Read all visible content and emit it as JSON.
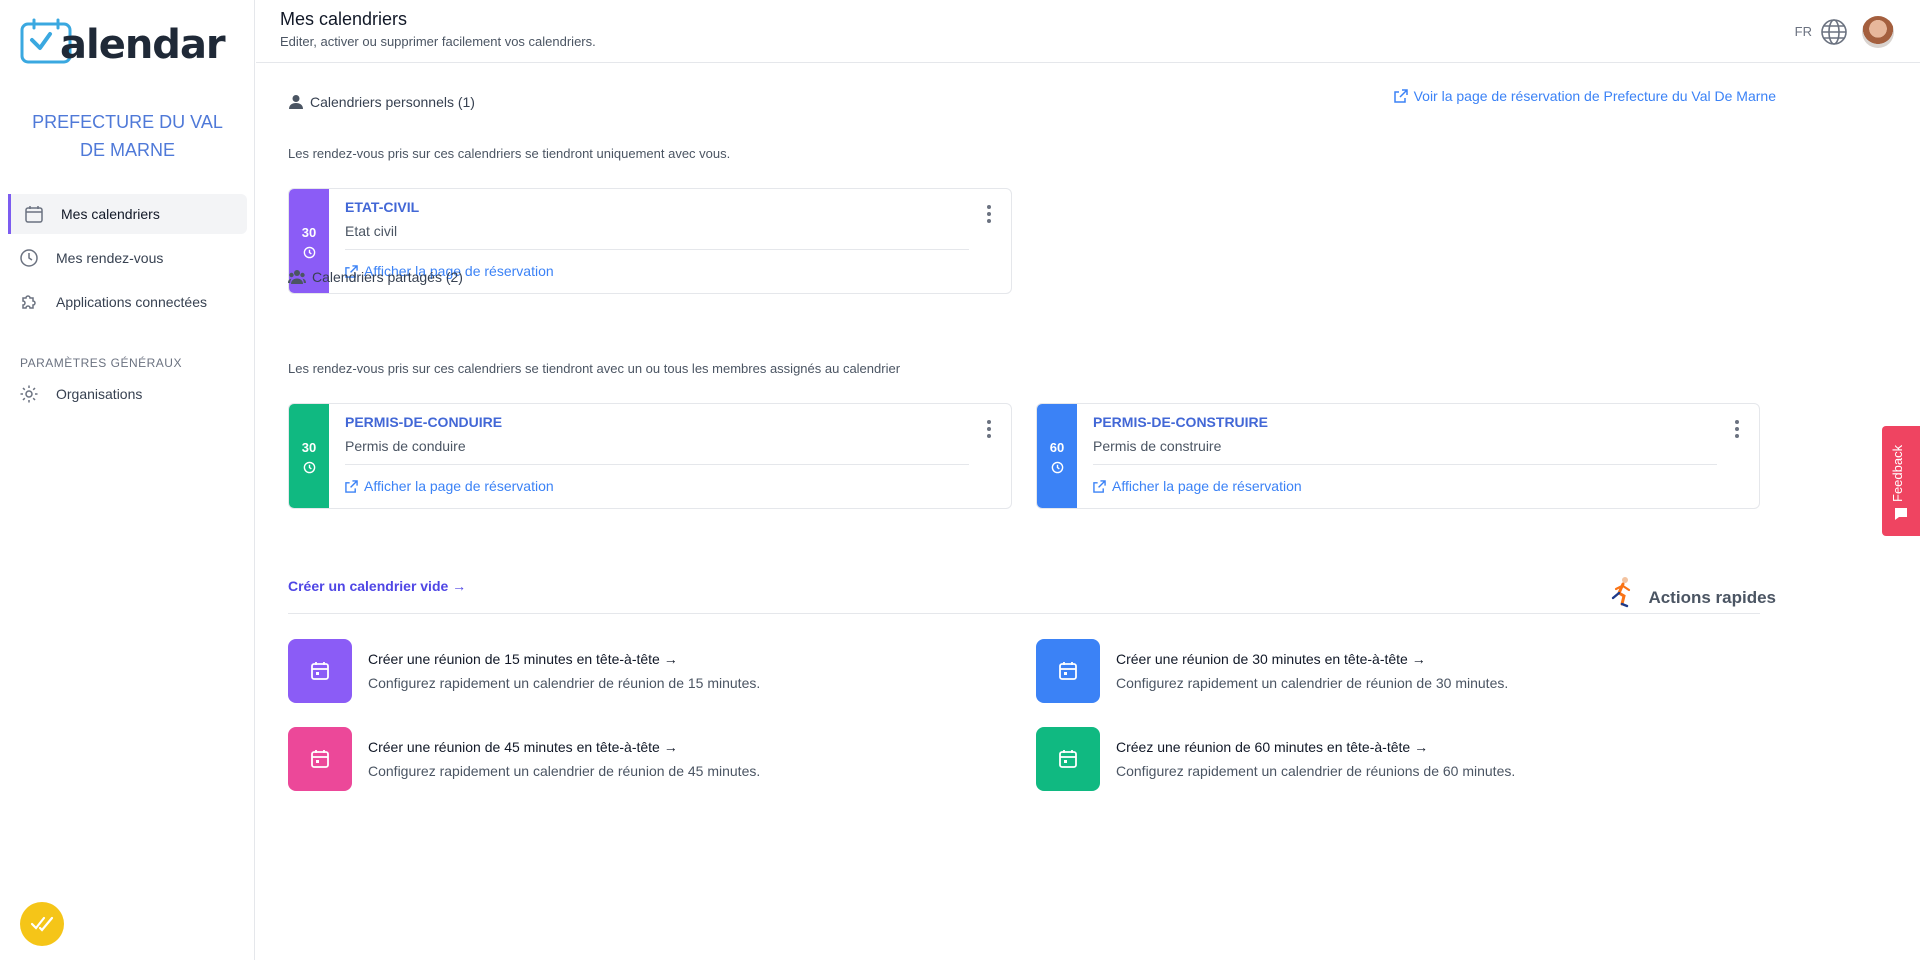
{
  "app": {
    "logo_text": "alendar"
  },
  "sidebar": {
    "org_name": "PREFECTURE DU VAL DE MARNE",
    "items": [
      {
        "label": "Mes calendriers",
        "icon": "calendar-icon",
        "active": true
      },
      {
        "label": "Mes rendez-vous",
        "icon": "clock-icon",
        "active": false
      },
      {
        "label": "Applications connectées",
        "icon": "puzzle-icon",
        "active": false
      }
    ],
    "section_label": "PARAMÈTRES GÉNÉRAUX",
    "settings_items": [
      {
        "label": "Organisations",
        "icon": "gear-icon"
      }
    ]
  },
  "header": {
    "title": "Mes calendriers",
    "subtitle": "Editer, activer ou supprimer facilement vos calendriers.",
    "lang": "FR"
  },
  "main": {
    "reservation_link": "Voir la page de réservation de Prefecture du Val De Marne",
    "personal": {
      "heading": "Calendriers personnels (1)",
      "description": "Les rendez-vous pris sur ces calendriers se tiendront uniquement avec vous.",
      "cards": [
        {
          "duration": "30",
          "name": "ETAT-CIVIL",
          "desc": "Etat civil",
          "link": "Afficher la page de réservation",
          "color": "#8b5cf6"
        }
      ]
    },
    "shared": {
      "heading": "Calendriers partagés (2)",
      "description": "Les rendez-vous pris sur ces calendriers se tiendront avec un ou tous les membres assignés au calendrier",
      "cards": [
        {
          "duration": "30",
          "name": "PERMIS-DE-CONDUIRE",
          "desc": "Permis de conduire",
          "link": "Afficher la page de réservation",
          "color": "#10b981"
        },
        {
          "duration": "60",
          "name": "PERMIS-DE-CONSTRUIRE",
          "desc": "Permis de construire",
          "link": "Afficher la page de réservation",
          "color": "#3b82f6"
        }
      ]
    },
    "create_empty": "Créer un calendrier vide →",
    "quick_actions_title": "Actions rapides",
    "quick_actions": [
      {
        "title": "Créer une réunion de 15 minutes en tête-à-tête →",
        "desc": "Configurez rapidement un calendrier de réunion de 15 minutes.",
        "color": "#8b5cf6"
      },
      {
        "title": "Créer une réunion de 30 minutes en tête-à-tête →",
        "desc": "Configurez rapidement un calendrier de réunion de 30 minutes.",
        "color": "#3b82f6"
      },
      {
        "title": "Créer une réunion de 45 minutes en tête-à-tête →",
        "desc": "Configurez rapidement un calendrier de réunion de 45 minutes.",
        "color": "#ec4899"
      },
      {
        "title": "Créez une réunion de 60 minutes en tête-à-tête →",
        "desc": "Configurez rapidement un calendrier de réunions de 60 minutes.",
        "color": "#10b981"
      }
    ]
  },
  "feedback": {
    "label": "Feedback",
    "color": "#ef4461"
  }
}
